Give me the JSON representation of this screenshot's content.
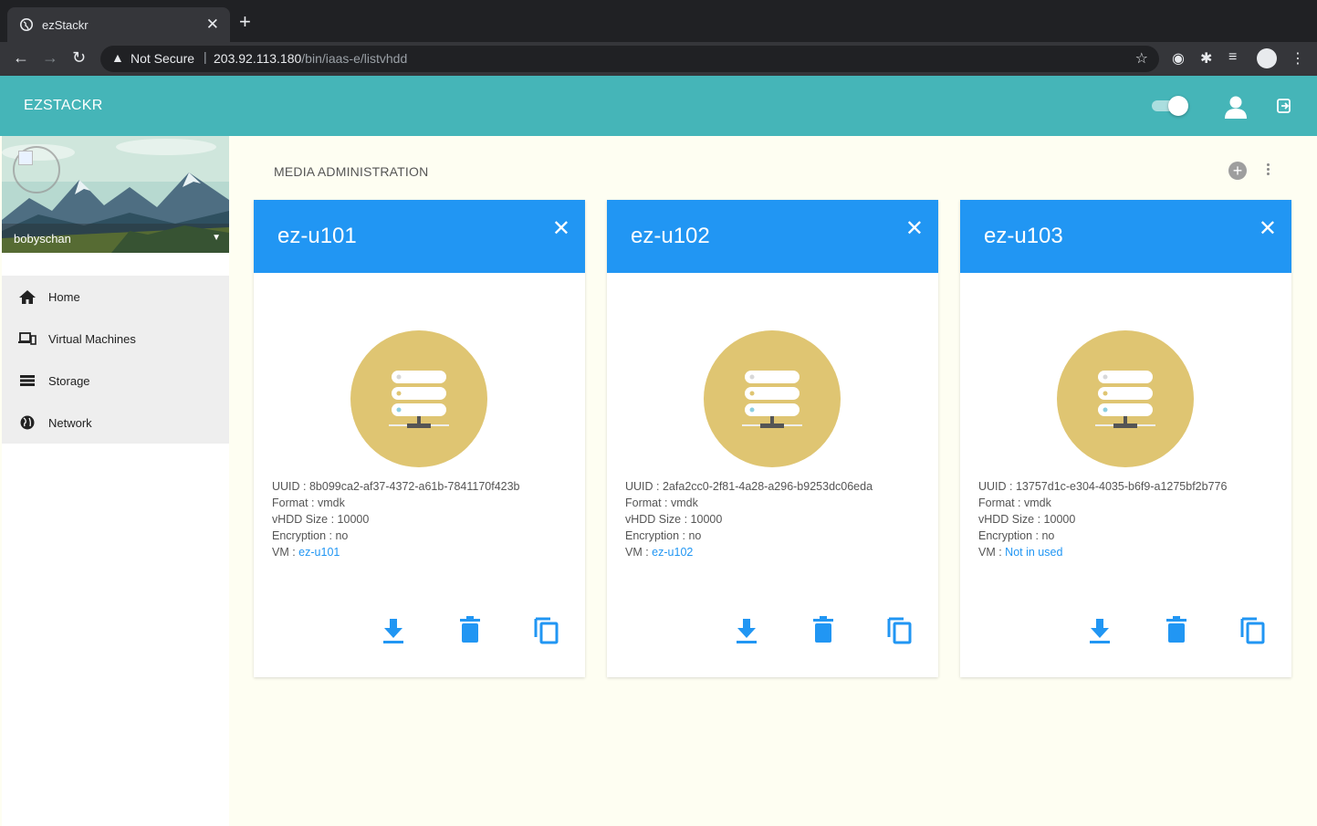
{
  "browser": {
    "tab_title": "ezStackr",
    "security_label": "Not Secure",
    "url_host": "203.92.113.180",
    "url_path": "/bin/iaas-e/listvhdd"
  },
  "appbar": {
    "brand": "EZSTACKR"
  },
  "sidebar": {
    "username": "bobyschan",
    "items": [
      {
        "label": "Home",
        "icon": "home-icon"
      },
      {
        "label": "Virtual Machines",
        "icon": "devices-icon"
      },
      {
        "label": "Storage",
        "icon": "storage-icon"
      },
      {
        "label": "Network",
        "icon": "globe-icon"
      }
    ]
  },
  "content": {
    "title": "MEDIA ADMINISTRATION"
  },
  "cards": [
    {
      "title": "ez-u101",
      "uuid_label": "UUID : ",
      "uuid": "8b099ca2-af37-4372-a61b-7841170f423b",
      "format_label": "Format : ",
      "format": "vmdk",
      "size_label": "vHDD Size : ",
      "size": "10000",
      "enc_label": "Encryption : ",
      "encryption": "no",
      "vm_label": "VM : ",
      "vm": "ez-u101"
    },
    {
      "title": "ez-u102",
      "uuid_label": "UUID : ",
      "uuid": "2afa2cc0-2f81-4a28-a296-b9253dc06eda",
      "format_label": "Format : ",
      "format": "vmdk",
      "size_label": "vHDD Size : ",
      "size": "10000",
      "enc_label": "Encryption : ",
      "encryption": "no",
      "vm_label": "VM : ",
      "vm": "ez-u102"
    },
    {
      "title": "ez-u103",
      "uuid_label": "UUID : ",
      "uuid": "13757d1c-e304-4035-b6f9-a1275bf2b776",
      "format_label": "Format : ",
      "format": "vmdk",
      "size_label": "vHDD Size : ",
      "size": "10000",
      "enc_label": "Encryption : ",
      "encryption": "no",
      "vm_label": "VM : ",
      "vm": "Not in used"
    }
  ],
  "colors": {
    "appbar": "#45b5b8",
    "card_header": "#2196f3",
    "disk_circle": "#dfc572",
    "action_icon": "#2196f3"
  }
}
